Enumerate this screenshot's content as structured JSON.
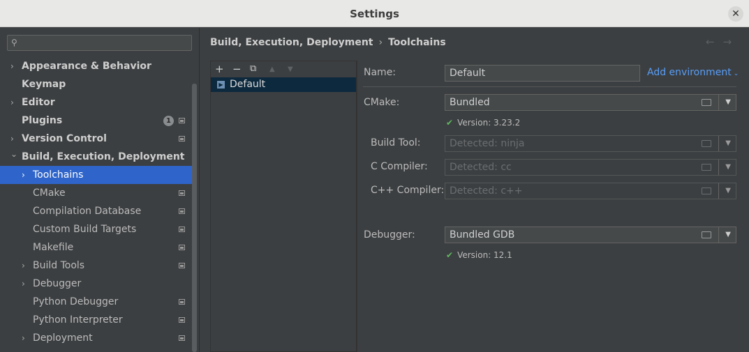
{
  "window": {
    "title": "Settings"
  },
  "sidebar": {
    "search": {
      "placeholder": ""
    },
    "items": [
      {
        "label": "Appearance & Behavior",
        "bold": true,
        "has_arrow": true,
        "expanded": false
      },
      {
        "label": "Keymap",
        "bold": true,
        "has_arrow": false
      },
      {
        "label": "Editor",
        "bold": true,
        "has_arrow": true,
        "expanded": false
      },
      {
        "label": "Plugins",
        "bold": true,
        "has_arrow": false,
        "badge": "1",
        "project_icon": true
      },
      {
        "label": "Version Control",
        "bold": true,
        "has_arrow": true,
        "expanded": false,
        "project_icon": true
      },
      {
        "label": "Build, Execution, Deployment",
        "bold": true,
        "has_arrow": true,
        "expanded": true
      },
      {
        "label": "Toolchains",
        "bold": false,
        "has_arrow": true,
        "expanded": false,
        "selected": true
      },
      {
        "label": "CMake",
        "bold": false,
        "has_arrow": false,
        "project_icon": true
      },
      {
        "label": "Compilation Database",
        "bold": false,
        "has_arrow": false,
        "project_icon": true
      },
      {
        "label": "Custom Build Targets",
        "bold": false,
        "has_arrow": false,
        "project_icon": true
      },
      {
        "label": "Makefile",
        "bold": false,
        "has_arrow": false,
        "project_icon": true
      },
      {
        "label": "Build Tools",
        "bold": false,
        "has_arrow": true,
        "expanded": false,
        "project_icon": true
      },
      {
        "label": "Debugger",
        "bold": false,
        "has_arrow": true,
        "expanded": false
      },
      {
        "label": "Python Debugger",
        "bold": false,
        "has_arrow": false,
        "project_icon": true
      },
      {
        "label": "Python Interpreter",
        "bold": false,
        "has_arrow": false,
        "project_icon": true
      },
      {
        "label": "Deployment",
        "bold": false,
        "has_arrow": true,
        "expanded": false,
        "project_icon": true
      }
    ]
  },
  "breadcrumb": {
    "parent": "Build, Execution, Deployment",
    "separator": "›",
    "current": "Toolchains"
  },
  "nav": {
    "back": "←",
    "forward": "→"
  },
  "toolchain_list": {
    "toolbar": {
      "add": "+",
      "remove": "−",
      "copy": "⧉",
      "up": "▲",
      "down": "▼"
    },
    "items": [
      {
        "label": "Default",
        "selected": true
      }
    ]
  },
  "form": {
    "name_label": "Name:",
    "name_value": "Default",
    "add_environment": "Add environment",
    "cmake_label": "CMake:",
    "cmake_value": "Bundled",
    "cmake_version": "Version: 3.23.2",
    "build_tool_label": "Build Tool:",
    "build_tool_value": "Detected: ninja",
    "c_compiler_label": "C Compiler:",
    "c_compiler_value": "Detected: cc",
    "cpp_compiler_label": "C++ Compiler:",
    "cpp_compiler_value": "Detected: c++",
    "debugger_label": "Debugger:",
    "debugger_value": "Bundled GDB",
    "debugger_version": "Version: 12.1"
  },
  "colors": {
    "selection": "#2f65ca",
    "link": "#589df6",
    "check": "#5fb85f",
    "background": "#3c3f41"
  }
}
